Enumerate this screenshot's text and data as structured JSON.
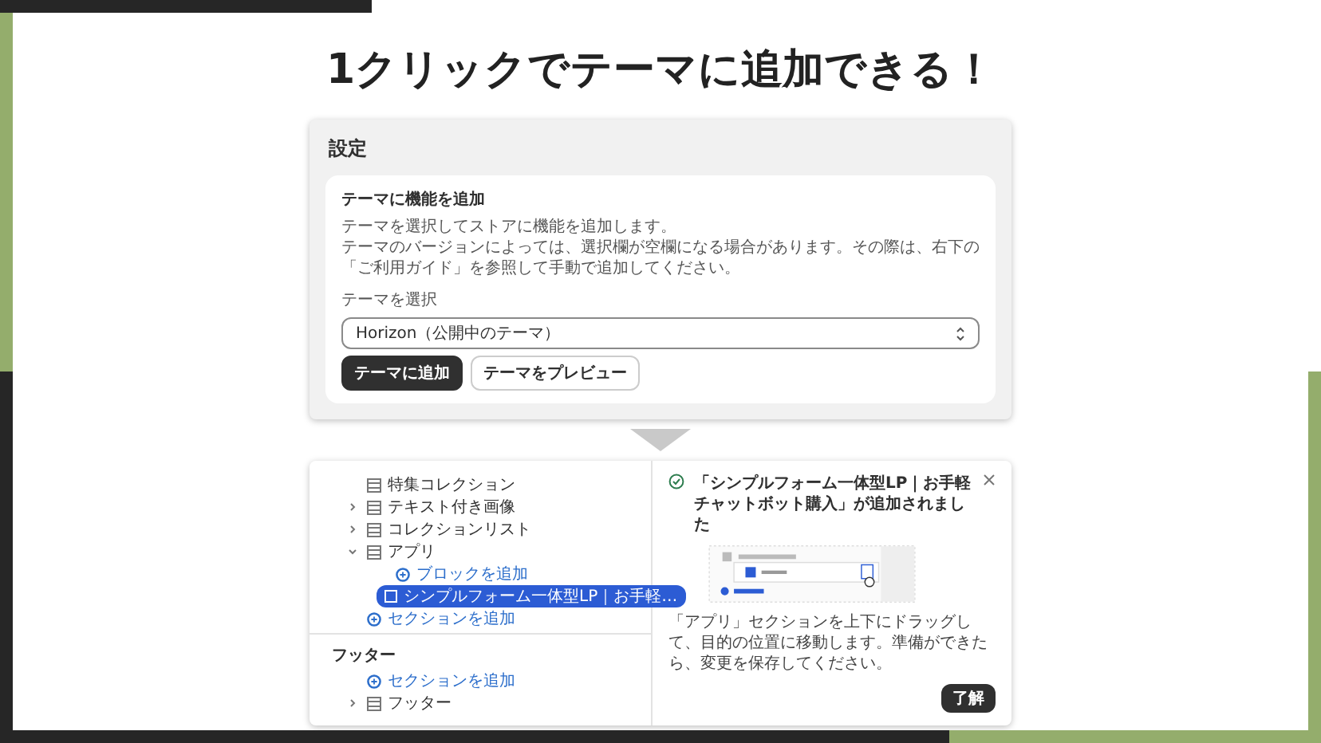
{
  "heading": "1クリックでテーマに追加できる！",
  "settings": {
    "title": "設定",
    "card": {
      "title": "テーマに機能を追加",
      "description": [
        "テーマを選択してストアに機能を追加します。",
        "テーマのバージョンによっては、選択欄が空欄になる場合があります。その際は、右下の「ご利用ガイド」を参照して手動で追加してください。"
      ],
      "select_label": "テーマを選択",
      "select_value": "Horizon（公開中のテーマ）",
      "buttons": [
        {
          "label": "テーマに追加",
          "primary": true
        },
        {
          "label": "テーマをプレビュー",
          "primary": false
        }
      ]
    }
  },
  "editor": {
    "sections": [
      {
        "items": [
          {
            "kind": "section",
            "label": "特集コレクション"
          },
          {
            "kind": "section",
            "label": "テキスト付き画像",
            "expanded": false
          },
          {
            "kind": "section",
            "label": "コレクションリスト",
            "expanded": false
          },
          {
            "kind": "section",
            "label": "アプリ",
            "expanded": true,
            "children": [
              {
                "kind": "add",
                "label": "ブロックを追加"
              },
              {
                "kind": "block",
                "label": "シンプルフォーム一体型LP｜お手軽…",
                "selected": true
              }
            ]
          },
          {
            "kind": "add",
            "label": "セクションを追加"
          }
        ]
      },
      {
        "heading": "フッター",
        "items": [
          {
            "kind": "add",
            "label": "セクションを追加"
          },
          {
            "kind": "section",
            "label": "フッター",
            "expanded": false
          }
        ]
      }
    ],
    "popover": {
      "title": "「シンプルフォーム一体型LP｜お手軽チャットボット購入」が追加されました",
      "body": "「アプリ」セクションを上下にドラッグして、目的の位置に移動します。準備ができたら、変更を保存してください。",
      "button": "了解"
    }
  }
}
